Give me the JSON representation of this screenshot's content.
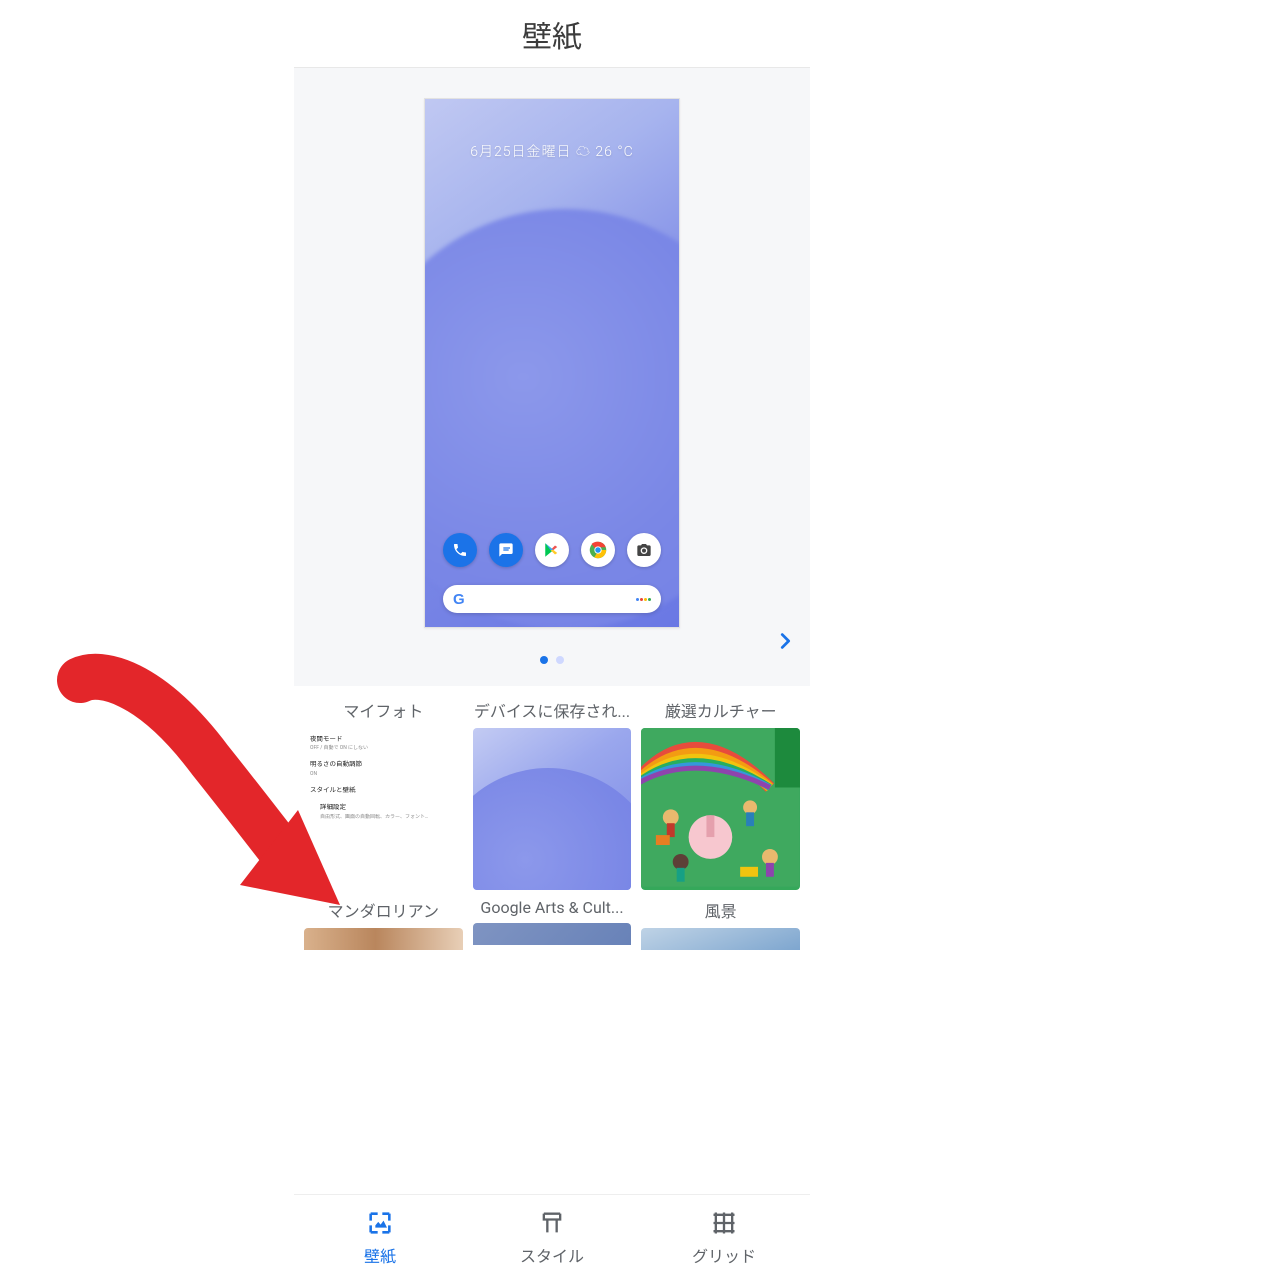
{
  "header": {
    "title": "壁紙"
  },
  "preview": {
    "date_weather": "6月25日金曜日 ☁ 26 °C",
    "pages": {
      "total": 2,
      "active": 0
    }
  },
  "categories": [
    {
      "title": "マイフォト",
      "settings": [
        {
          "t": "夜間モード",
          "s": "OFF / 自動で ON にしない"
        },
        {
          "t": "明るさの自動調節",
          "s": "ON"
        },
        {
          "t": "スタイルと壁紙",
          "s": ""
        },
        {
          "t": "詳細設定",
          "s": "自由形式、画面の自動回転、カラー、フォント…"
        }
      ]
    },
    {
      "title": "デバイスに保存され..."
    },
    {
      "title": "厳選カルチャー"
    },
    {
      "title": "マンダロリアン"
    },
    {
      "title": "Google Arts & Cult..."
    },
    {
      "title": "風景"
    }
  ],
  "nav": {
    "items": [
      {
        "label": "壁紙"
      },
      {
        "label": "スタイル"
      },
      {
        "label": "グリッド"
      }
    ],
    "active": 0
  },
  "colors": {
    "accent": "#1a73e8"
  }
}
